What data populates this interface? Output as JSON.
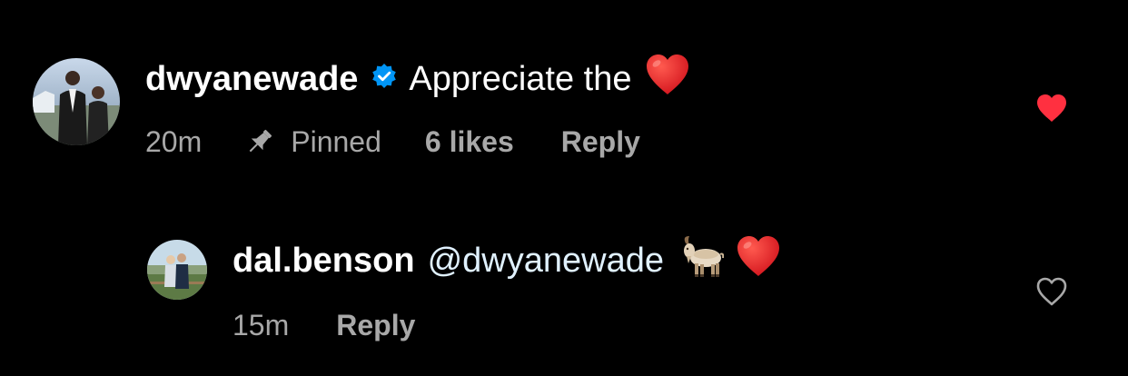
{
  "comments": [
    {
      "username": "dwyanewade",
      "verified": true,
      "text": "Appreciate the",
      "emoji": "red-heart",
      "time": "20m",
      "pinned_label": "Pinned",
      "likes_label": "6 likes",
      "reply_label": "Reply",
      "liked": true,
      "like_color": "#ff3040"
    },
    {
      "username": "dal.benson",
      "verified": false,
      "mention": "@dwyanewade",
      "emojis": [
        "goat",
        "red-heart"
      ],
      "time": "15m",
      "reply_label": "Reply",
      "liked": false
    }
  ],
  "colors": {
    "background": "#000000",
    "primary_text": "#ffffff",
    "secondary_text": "#a8a8a8",
    "verified_blue": "#0095f6",
    "heart_red": "#ff3040"
  }
}
